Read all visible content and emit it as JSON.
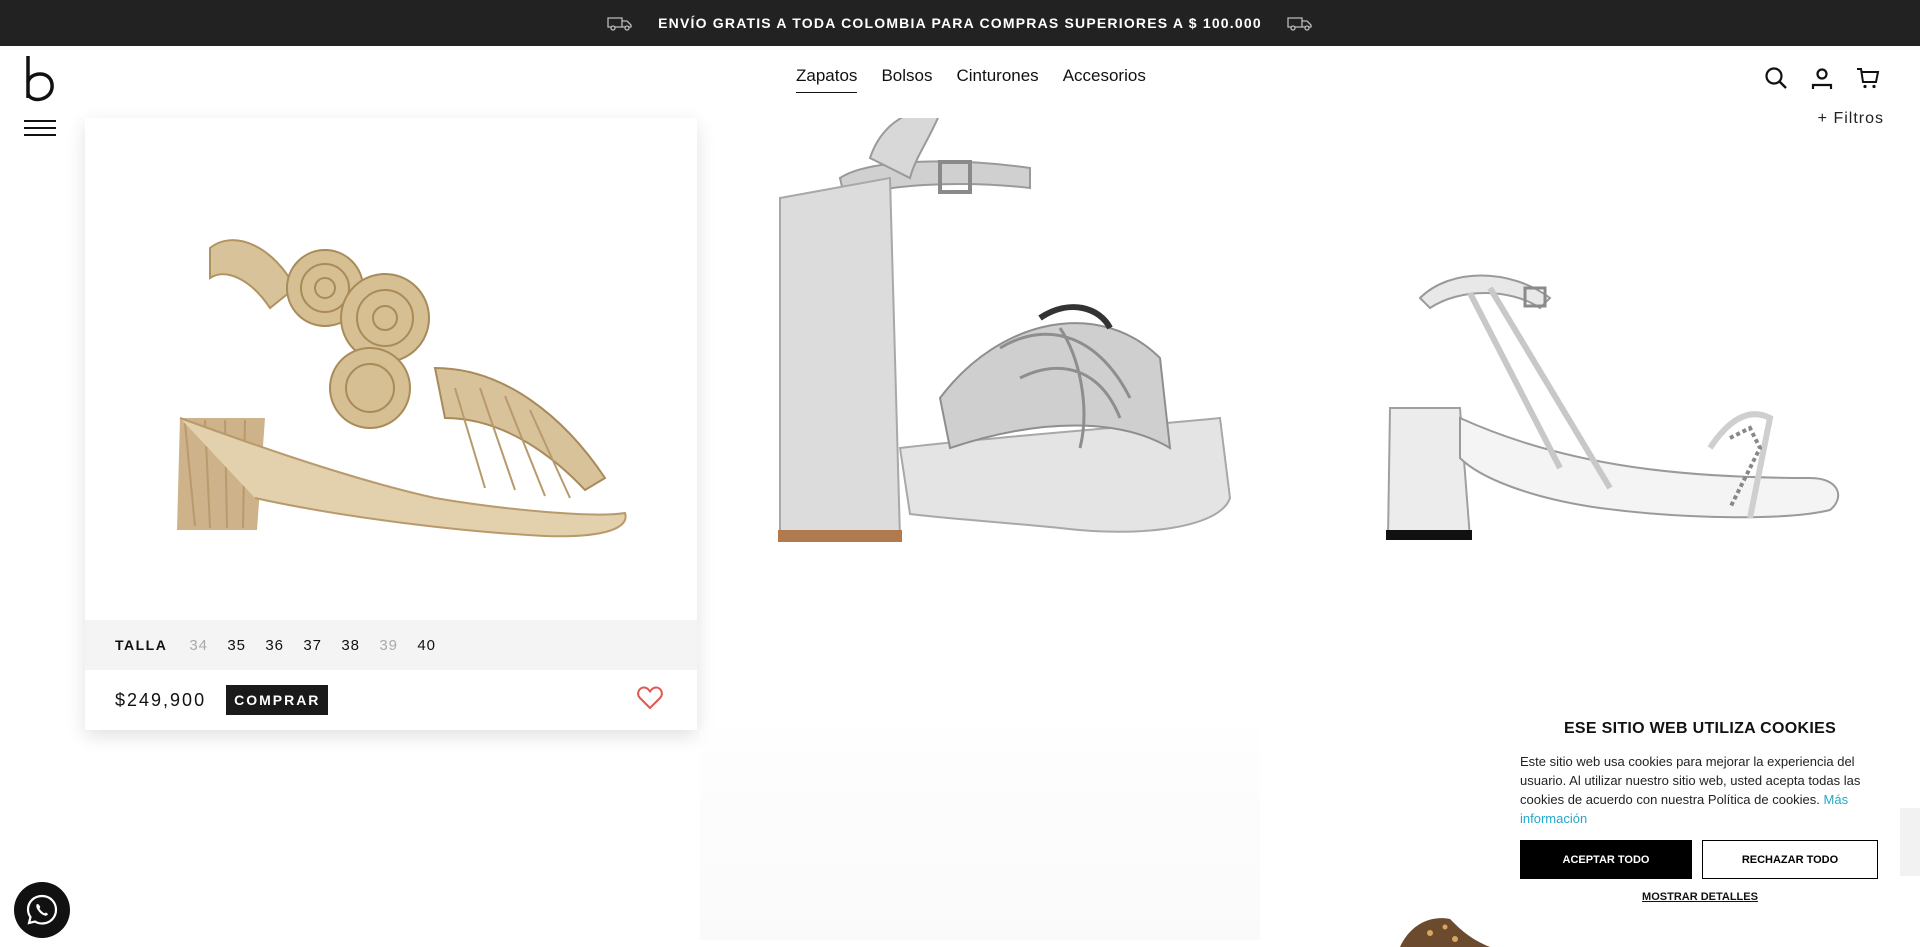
{
  "promo": {
    "text": "ENVÍO GRATIS A TODA COLOMBIA PARA COMPRAS SUPERIORES A $ 100.000"
  },
  "nav": {
    "items": [
      {
        "label": "Zapatos",
        "active": true
      },
      {
        "label": "Bolsos",
        "active": false
      },
      {
        "label": "Cinturones",
        "active": false
      },
      {
        "label": "Accesorios",
        "active": false
      }
    ]
  },
  "filters": {
    "label": "+ Filtros"
  },
  "products": [
    {
      "size_label": "TALLA",
      "sizes": [
        {
          "value": "34",
          "available": false
        },
        {
          "value": "35",
          "available": true
        },
        {
          "value": "36",
          "available": true
        },
        {
          "value": "37",
          "available": true
        },
        {
          "value": "38",
          "available": true
        },
        {
          "value": "39",
          "available": false
        },
        {
          "value": "40",
          "available": true
        }
      ],
      "price": "$249,900",
      "buy_label": "COMPRAR",
      "image_color": "#d8c29a"
    },
    {
      "image_color": "#c8c8c8"
    },
    {
      "image_color": "#ededed"
    }
  ],
  "cookie": {
    "title": "ESE SITIO WEB UTILIZA COOKIES",
    "text": "Este sitio web usa cookies para mejorar la experiencia del usuario. Al utilizar nuestro sitio web, usted acepta todas las cookies de acuerdo con nuestra Política de cookies. ",
    "more_link": "Más información",
    "accept": "ACEPTAR TODO",
    "reject": "RECHAZAR TODO",
    "details": "MOSTRAR DETALLES"
  },
  "colors": {
    "promo_bg": "#222222",
    "accent_link": "#25a7c9",
    "heart": "#e0584f"
  }
}
